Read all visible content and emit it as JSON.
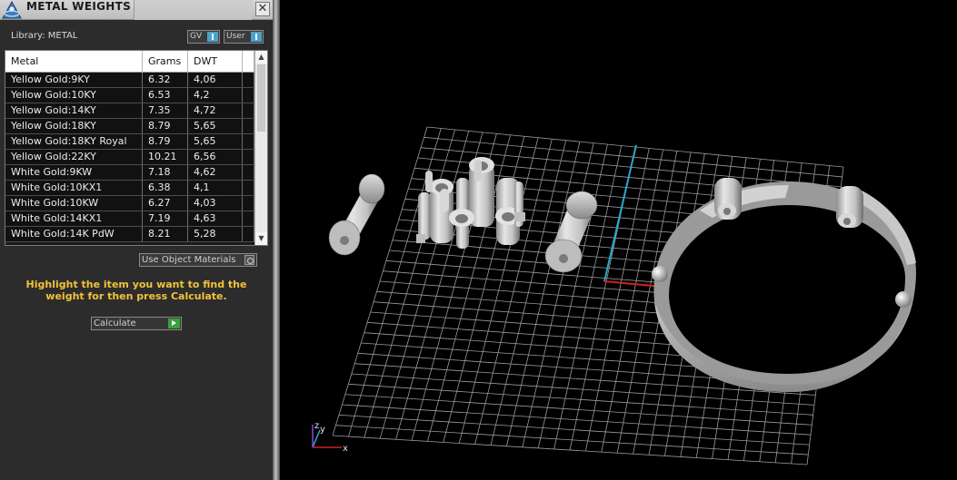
{
  "panel": {
    "title": "METAL WEIGHTS",
    "close_glyph": "✕",
    "library_label": "Library: METAL",
    "gv_label": "GV",
    "user_label": "User",
    "use_object_materials_label": "Use Object Materials",
    "hint": "Highlight the item you want to find the weight for then press Calculate.",
    "calculate_label": "Calculate"
  },
  "table": {
    "columns": [
      "Metal",
      "Grams",
      "DWT"
    ],
    "rows": [
      {
        "metal": "Yellow Gold:9KY",
        "grams": "6.32",
        "dwt": "4,06"
      },
      {
        "metal": "Yellow Gold:10KY",
        "grams": "6.53",
        "dwt": "4,2"
      },
      {
        "metal": "Yellow Gold:14KY",
        "grams": "7.35",
        "dwt": "4,72"
      },
      {
        "metal": "Yellow Gold:18KY",
        "grams": "8.79",
        "dwt": "5,65"
      },
      {
        "metal": "Yellow Gold:18KY Royal",
        "grams": "8.79",
        "dwt": "5,65"
      },
      {
        "metal": "Yellow Gold:22KY",
        "grams": "10.21",
        "dwt": "6,56"
      },
      {
        "metal": "White Gold:9KW",
        "grams": "7.18",
        "dwt": "4,62"
      },
      {
        "metal": "White Gold:10KX1",
        "grams": "6.38",
        "dwt": "4,1"
      },
      {
        "metal": "White Gold:10KW",
        "grams": "6.27",
        "dwt": "4,03"
      },
      {
        "metal": "White Gold:14KX1",
        "grams": "7.19",
        "dwt": "4,63"
      },
      {
        "metal": "White Gold:14K PdW",
        "grams": "8.21",
        "dwt": "5,28"
      }
    ]
  },
  "viewport": {
    "axis_x_label": "x",
    "axis_y_label": "y",
    "axis_z_label": "z"
  },
  "colors": {
    "hint_text": "#f4c23a",
    "toggle_accent": "#4aa3c8",
    "calculate_go": "#3aa03a",
    "axis_red": "#cc2222",
    "axis_cyan": "#2aa7c7"
  },
  "icons": [
    "app-logo-icon",
    "close-icon",
    "toggle-icon",
    "object-material-icon",
    "play-icon"
  ]
}
